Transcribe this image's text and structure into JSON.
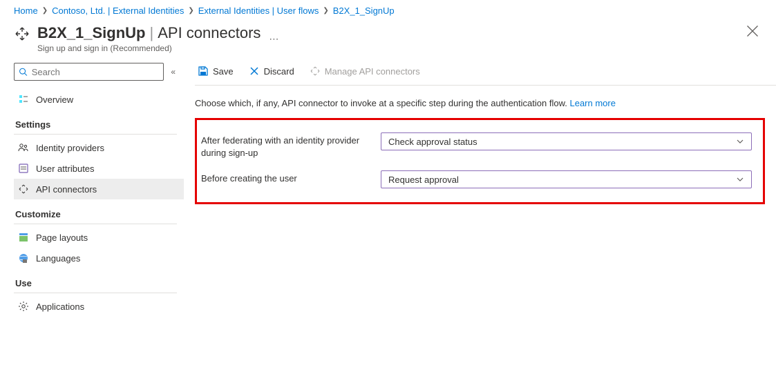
{
  "breadcrumb": {
    "items": [
      "Home",
      "Contoso, Ltd. | External Identities",
      "External Identities | User flows",
      "B2X_1_SignUp"
    ]
  },
  "header": {
    "title_bold": "B2X_1_SignUp",
    "title_thin": "API connectors",
    "subtitle": "Sign up and sign in (Recommended)"
  },
  "search": {
    "placeholder": "Search"
  },
  "sidebar": {
    "overview": "Overview",
    "heading_settings": "Settings",
    "identity_providers": "Identity providers",
    "user_attributes": "User attributes",
    "api_connectors": "API connectors",
    "heading_customize": "Customize",
    "page_layouts": "Page layouts",
    "languages": "Languages",
    "heading_use": "Use",
    "applications": "Applications"
  },
  "toolbar": {
    "save": "Save",
    "discard": "Discard",
    "manage": "Manage API connectors"
  },
  "main": {
    "description": "Choose which, if any, API connector to invoke at a specific step during the authentication flow.",
    "learn_more": "Learn more",
    "field1_label": "After federating with an identity provider during sign-up",
    "field1_value": "Check approval status",
    "field2_label": "Before creating the user",
    "field2_value": "Request approval"
  }
}
